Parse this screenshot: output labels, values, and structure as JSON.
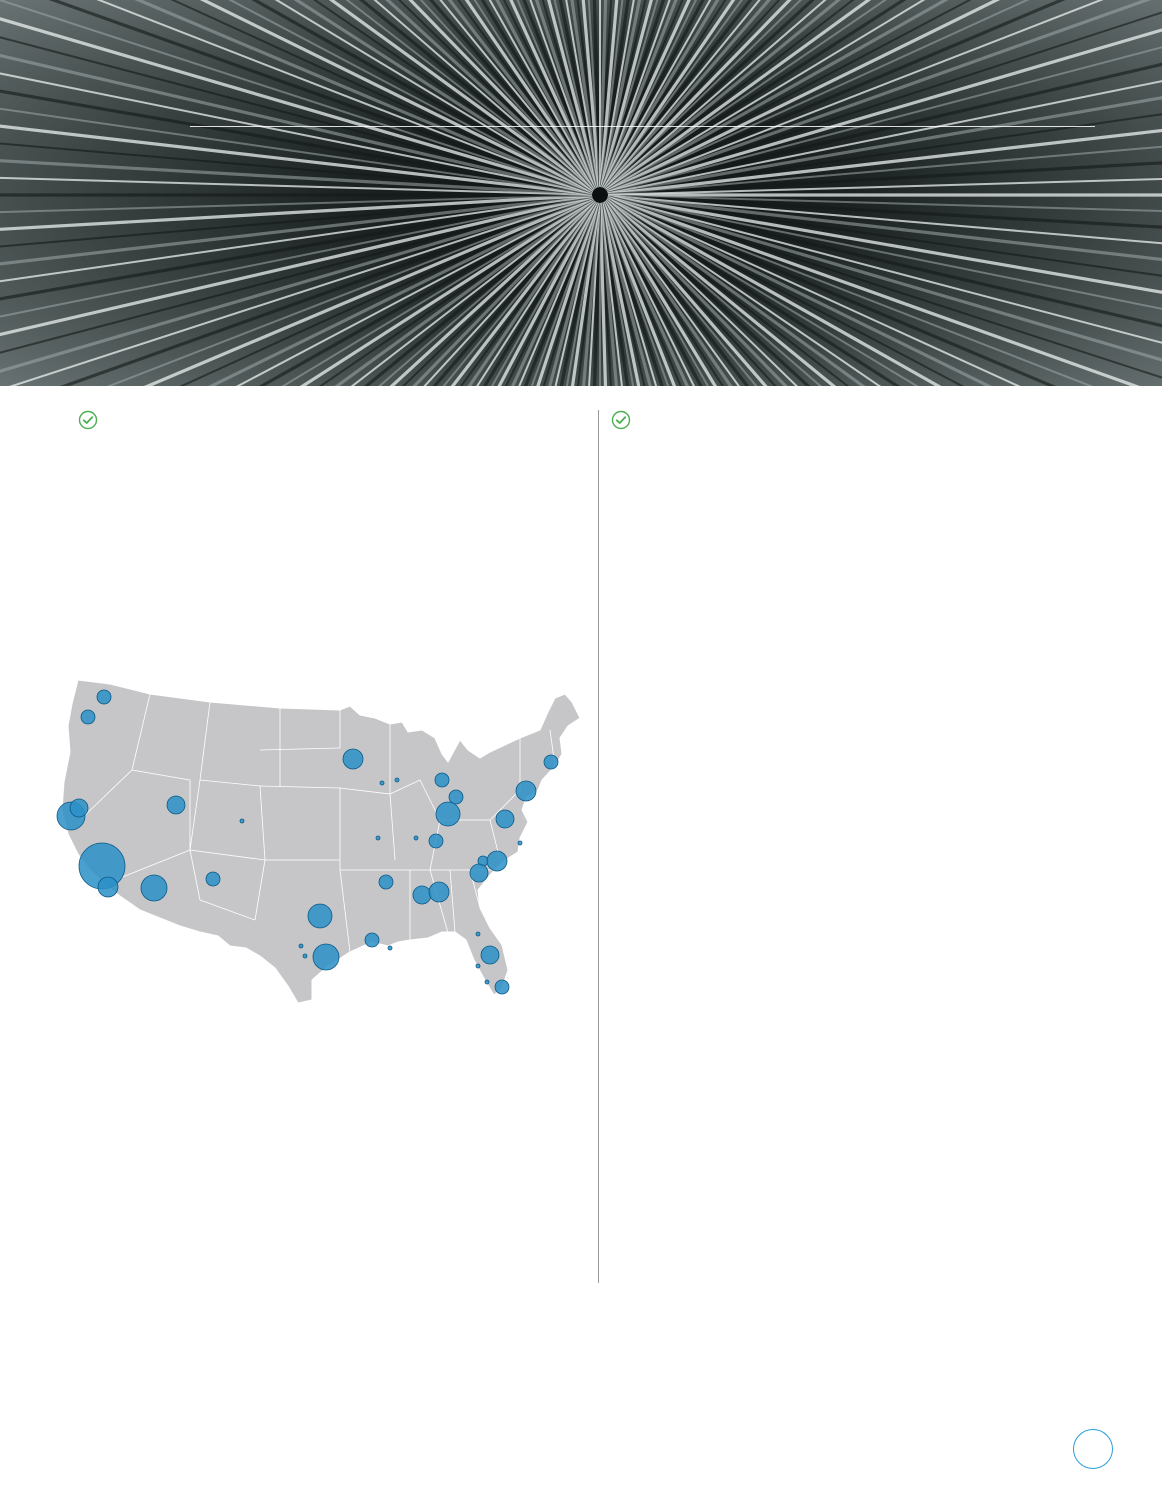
{
  "hero": {
    "image": "radial-burst-photo"
  },
  "sections": [
    {
      "icon": "check-circle-icon"
    },
    {
      "icon": "check-circle-icon"
    }
  ],
  "map": {
    "region": "United States",
    "land_color": "#c6c6c9",
    "border_color": "#ffffff",
    "bubble_color": "#2a8fc7",
    "bubble_stroke": "#0b5a86"
  },
  "page_number": "",
  "accent": "#2a9fd8",
  "check_color": "#4caf50"
}
